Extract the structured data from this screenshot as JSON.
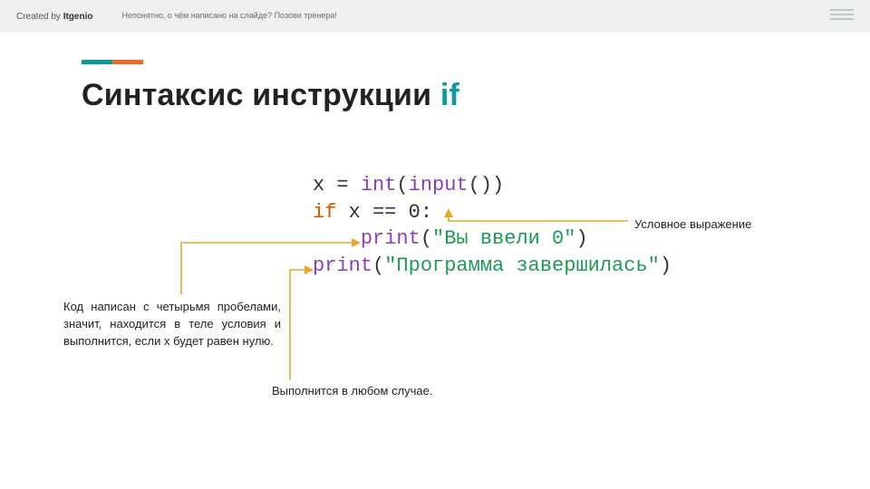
{
  "header": {
    "created_prefix": "Created by ",
    "created_brand": "Itgenio",
    "tip": "Непонятно, о чём написано на слайде? Позови тренера!"
  },
  "title": {
    "main": "Синтаксис инструкции ",
    "keyword": "if"
  },
  "code": {
    "l1_a": "x = ",
    "l1_b": "int",
    "l1_c": "(",
    "l1_d": "input",
    "l1_e": "())",
    "l2_a": "if",
    "l2_b": " x == 0:",
    "l3_ind": "    ",
    "l3_a": "print",
    "l3_b": "(",
    "l3_c": "\"Вы ввели 0\"",
    "l3_d": ")",
    "l4_a": "print",
    "l4_b": "(",
    "l4_c": "\"Программа завершилась\"",
    "l4_d": ")"
  },
  "annotations": {
    "conditional_expr": "Условное выражение",
    "indent_body": "Код написан с четырьмя пробелами, значит, находится в теле условия и выполнится, если x будет равен нулю.",
    "always_runs": "Выполнится в любом случае."
  },
  "colors": {
    "teal": "#0c9aa0",
    "orange": "#e96f29",
    "arrow": "#e7a92d"
  }
}
